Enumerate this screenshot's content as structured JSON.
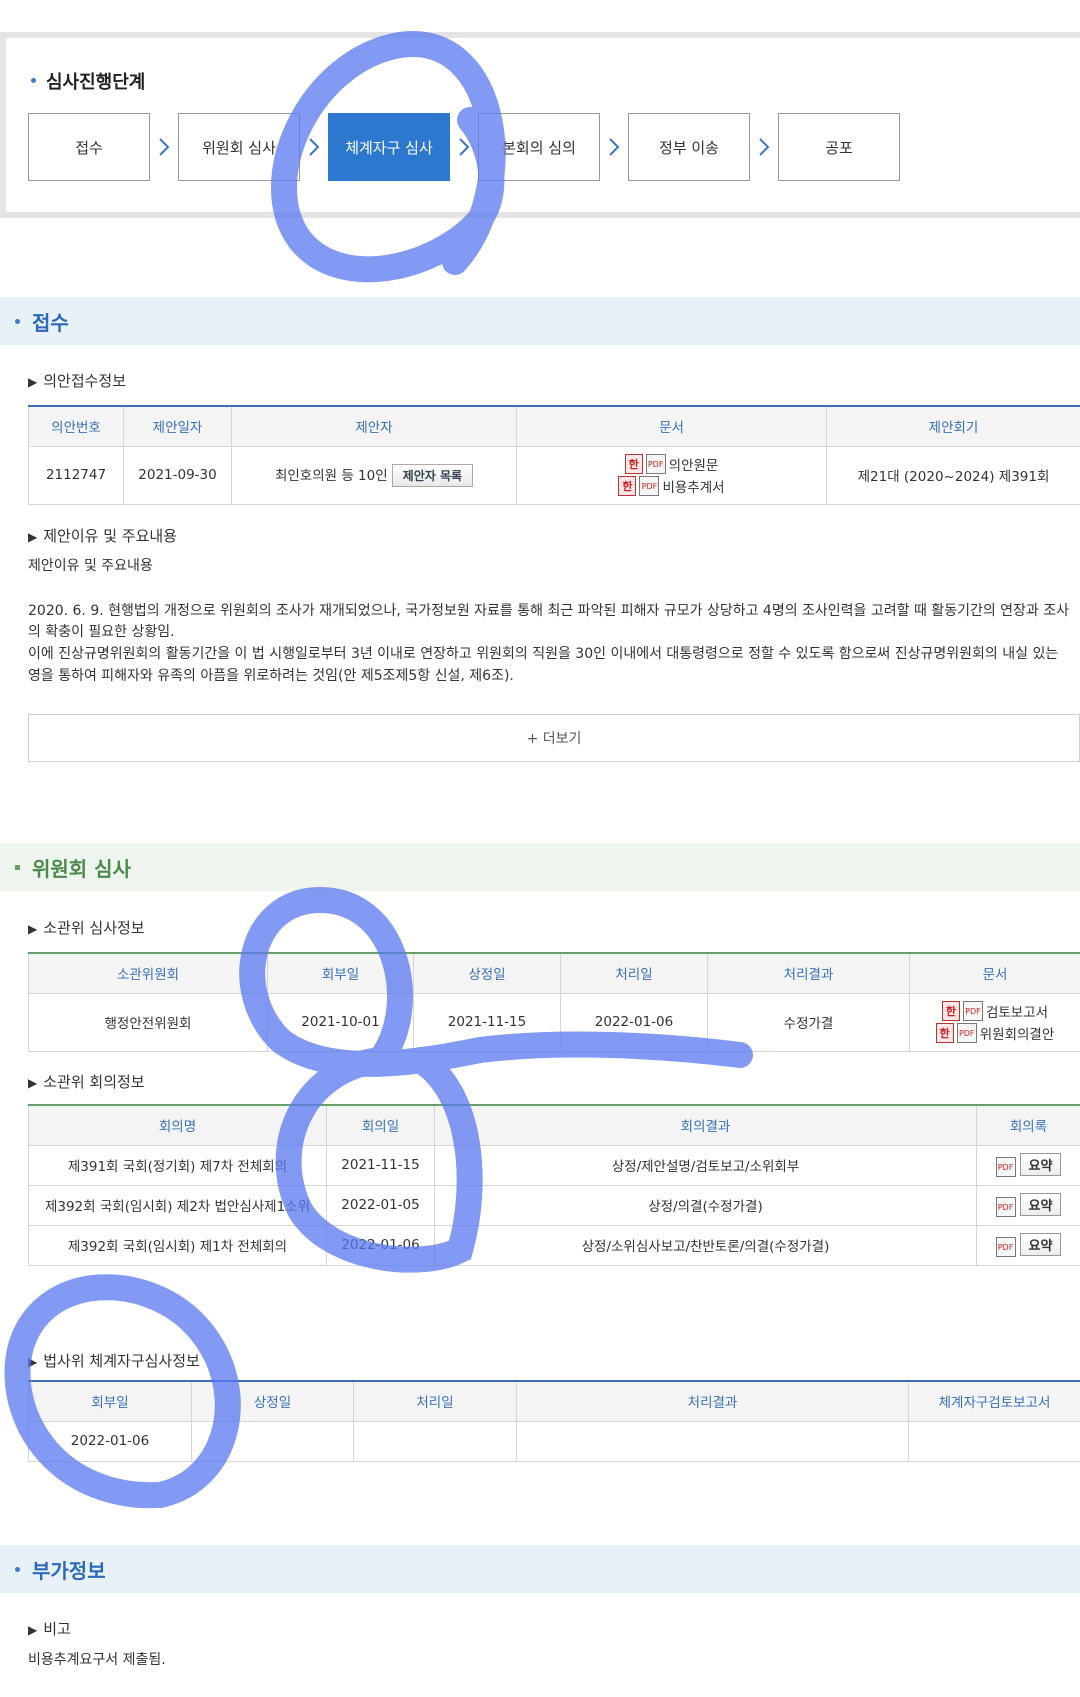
{
  "progress": {
    "title": "심사진행단계",
    "steps": [
      "접수",
      "위원회 심사",
      "체계자구 심사",
      "본회의 심의",
      "정부 이송",
      "공포"
    ],
    "active_index": 2
  },
  "reception": {
    "title": "접수",
    "info_heading": "의안접수정보",
    "headers": [
      "의안번호",
      "제안일자",
      "제안자",
      "문서",
      "제안회기"
    ],
    "row": {
      "bill_no": "2112747",
      "date": "2021-09-30",
      "proposer": "최인호의원 등 10인",
      "proposer_button": "제안자 목록",
      "docs": [
        "의안원문",
        "비용추계서"
      ],
      "session": "제21대 (2020~2024) 제391회"
    },
    "reason_heading": "제안이유 및 주요내용",
    "reason_label": "제안이유 및 주요내용",
    "reason_p1": "2020. 6. 9. 현행법의 개정으로 위원회의 조사가 재개되었으나, 국가정보원 자료를 통해 최근 파악된 피해자 규모가 상당하고 4명의 조사인력을 고려할 때 활동기간의 연장과 조사",
    "reason_p1b": "의 확충이 필요한 상황임.",
    "reason_p2": "이에 진상규명위원회의 활동기간을 이 법 시행일로부터 3년 이내로 연장하고 위원회의 직원을 30인 이내에서 대통령령으로 정할 수 있도록 함으로써 진상규명위원회의 내실 있는",
    "reason_p2b": "영을 통하여 피해자와 유족의 아픔을 위로하려는 것임(안 제5조제5항 신설, 제6조).",
    "more_label": "+ 더보기"
  },
  "committee": {
    "title": "위원회 심사",
    "review_heading": "소관위 심사정보",
    "review_headers": [
      "소관위원회",
      "회부일",
      "상정일",
      "처리일",
      "처리결과",
      "문서"
    ],
    "review_row": {
      "committee": "행정안전위원회",
      "referred": "2021-10-01",
      "presented": "2021-11-15",
      "processed": "2022-01-06",
      "result": "수정가결",
      "docs": [
        "검토보고서",
        "위원회의결안"
      ]
    },
    "meeting_heading": "소관위 회의정보",
    "meeting_headers": [
      "회의명",
      "회의일",
      "회의결과",
      "회의록"
    ],
    "meetings": [
      {
        "name": "제391회 국회(정기회) 제7차 전체회의",
        "date": "2021-11-15",
        "result": "상정/제안설명/검토보고/소위회부",
        "btn": "요약"
      },
      {
        "name": "제392회 국회(임시회) 제2차 법안심사제1소위",
        "date": "2022-01-05",
        "result": "상정/의결(수정가결)",
        "btn": "요약"
      },
      {
        "name": "제392회 국회(임시회) 제1차 전체회의",
        "date": "2022-01-06",
        "result": "상정/소위심사보고/찬반토론/의결(수정가결)",
        "btn": "요약"
      }
    ],
    "legal_heading": "법사위 체계자구심사정보",
    "legal_headers": [
      "회부일",
      "상정일",
      "처리일",
      "처리결과",
      "체계자구검토보고서"
    ],
    "legal_row": {
      "referred": "2022-01-06",
      "presented": "",
      "processed": "",
      "result": "",
      "report": ""
    }
  },
  "extra": {
    "title": "부가정보",
    "note_heading": "비고",
    "note_text": "비용추계요구서 제출됨."
  },
  "colors": {
    "accent": "#2d78cf",
    "annotation": "#5a78f0"
  }
}
